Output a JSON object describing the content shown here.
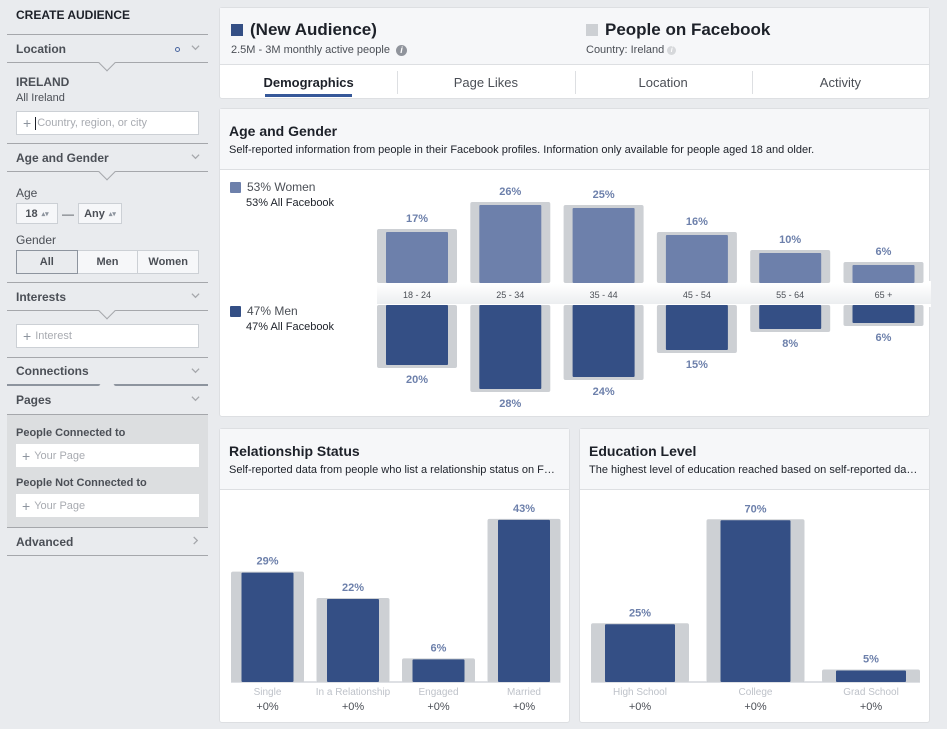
{
  "sidebar": {
    "title": "CREATE AUDIENCE",
    "location": {
      "label": "Location",
      "country": "IRELAND",
      "region": "All Ireland",
      "placeholder": "Country, region, or city"
    },
    "age_gender": {
      "label": "Age and Gender",
      "age_label": "Age",
      "age_min": "18",
      "age_max": "Any",
      "gender_label": "Gender",
      "gender_options": [
        "All",
        "Men",
        "Women"
      ],
      "gender_selected": "All"
    },
    "interests": {
      "label": "Interests",
      "placeholder": "Interest"
    },
    "connections": {
      "label": "Connections"
    },
    "pages": {
      "label": "Pages",
      "connected_label": "People Connected to",
      "connected_placeholder": "Your Page",
      "not_connected_label": "People Not Connected to",
      "not_connected_placeholder": "Your Page"
    },
    "advanced": {
      "label": "Advanced"
    }
  },
  "header": {
    "audience": {
      "title": "(New Audience)",
      "subtitle": "2.5M - 3M monthly active people",
      "color": "#3b5998"
    },
    "comparison": {
      "title": "People on Facebook",
      "subtitle": "Country: Ireland",
      "color": "#cdd0d4"
    },
    "tabs": [
      "Demographics",
      "Page Likes",
      "Location",
      "Activity"
    ],
    "active_tab": "Demographics"
  },
  "age_gender": {
    "title": "Age and Gender",
    "description": "Self-reported information from people in their Facebook profiles. Information only available for people aged 18 and older.",
    "women": {
      "label": "53% Women",
      "sub": "53% All Facebook",
      "color": "#6d80ab"
    },
    "men": {
      "label": "47% Men",
      "sub": "47% All Facebook",
      "color": "#344f85"
    }
  },
  "relationship": {
    "title": "Relationship Status",
    "description": "Self-reported data from people who list a relationship status on Facebook."
  },
  "education": {
    "title": "Education Level",
    "description": "The highest level of education reached based on self-reported data..."
  },
  "chart_data": [
    {
      "type": "bar",
      "title": "Age and Gender",
      "categories": [
        "18 - 24",
        "25 - 34",
        "35 - 44",
        "45 - 54",
        "55 - 64",
        "65 +"
      ],
      "series": [
        {
          "name": "Women",
          "values": [
            17,
            26,
            25,
            16,
            10,
            6
          ],
          "labels": [
            "17%",
            "26%",
            "25%",
            "16%",
            "10%",
            "6%"
          ]
        },
        {
          "name": "Men",
          "values": [
            20,
            28,
            24,
            15,
            8,
            6
          ],
          "labels": [
            "20%",
            "28%",
            "24%",
            "15%",
            "8%",
            "6%"
          ]
        }
      ],
      "comparison_series": [
        {
          "name": "Women - All Facebook",
          "values": [
            17,
            26,
            25,
            16,
            10,
            6
          ]
        },
        {
          "name": "Men - All Facebook",
          "values": [
            20,
            28,
            24,
            15,
            8,
            6
          ]
        }
      ],
      "orientation": "mirrored",
      "unit": "%"
    },
    {
      "type": "bar",
      "title": "Relationship Status",
      "categories": [
        "Single",
        "In a Relationship",
        "Engaged",
        "Married"
      ],
      "values": [
        29,
        22,
        6,
        43
      ],
      "labels": [
        "29%",
        "22%",
        "6%",
        "43%"
      ],
      "comparison_values": [
        29,
        22,
        6,
        43
      ],
      "deltas": [
        "+0%",
        "+0%",
        "+0%",
        "+0%"
      ],
      "unit": "%"
    },
    {
      "type": "bar",
      "title": "Education Level",
      "categories": [
        "High School",
        "College",
        "Grad School"
      ],
      "values": [
        25,
        70,
        5
      ],
      "labels": [
        "25%",
        "70%",
        "5%"
      ],
      "comparison_values": [
        25,
        70,
        5
      ],
      "deltas": [
        "+0%",
        "+0%",
        "+0%"
      ],
      "unit": "%"
    }
  ],
  "colors": {
    "primary_bar": "#344f85",
    "women_bar": "#6d80ab",
    "comparison_bar": "#cdd0d4",
    "value_label": "#6d80ab",
    "category_label": "#bec2c9"
  }
}
